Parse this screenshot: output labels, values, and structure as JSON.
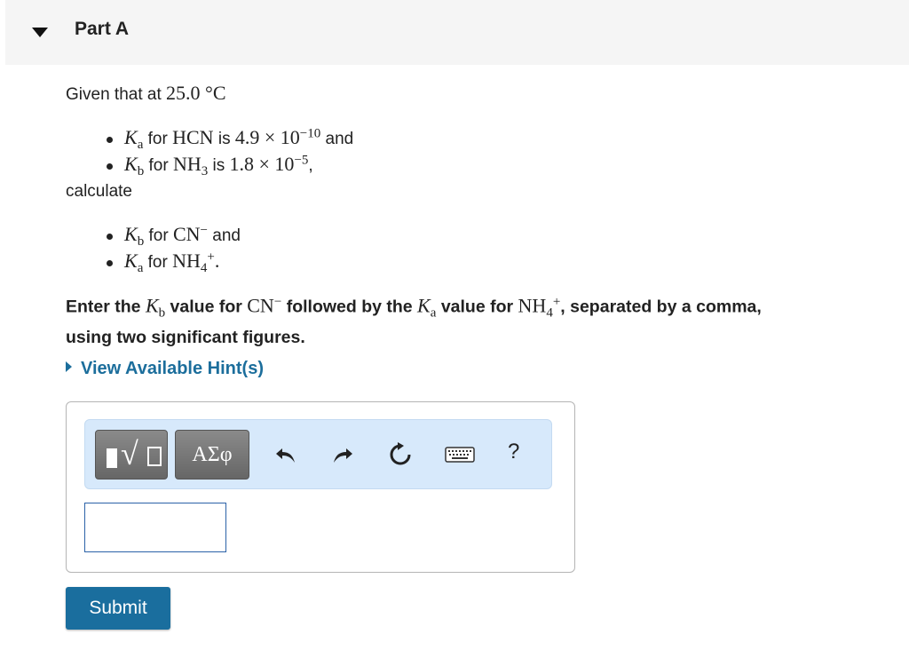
{
  "header": {
    "title": "Part A"
  },
  "question": {
    "intro_text": "Given that at",
    "temperature": "25.0 °C",
    "given": [
      {
        "symbol": "K",
        "sub": "a",
        "for_text": "for",
        "species": "HCN",
        "species_sup": "",
        "species_sub": "",
        "is_text": "is",
        "value": "4.9 × 10",
        "exponent": "−10",
        "tail": "and"
      },
      {
        "symbol": "K",
        "sub": "b",
        "for_text": "for",
        "species": "NH",
        "species_sub": "3",
        "species_sup": "",
        "is_text": "is",
        "value": "1.8 × 10",
        "exponent": "−5",
        "tail": ","
      }
    ],
    "calculate_text": "calculate",
    "targets": [
      {
        "symbol": "K",
        "sub": "b",
        "for_text": "for",
        "species": "CN",
        "species_sub": "",
        "species_sup": "−",
        "tail": "and"
      },
      {
        "symbol": "K",
        "sub": "a",
        "for_text": "for",
        "species": "NH",
        "species_sub": "4",
        "species_sup": "+",
        "tail": "."
      }
    ],
    "instruction": {
      "part1": "Enter the",
      "k1_symbol": "K",
      "k1_sub": "b",
      "part2": "value for",
      "sp1": "CN",
      "sp1_sup": "−",
      "part3": "followed by the",
      "k2_symbol": "K",
      "k2_sub": "a",
      "part4": "value for",
      "sp2": "NH",
      "sp2_sub": "4",
      "sp2_sup": "+",
      "part5": ", separated by a comma,",
      "line2": "using two significant figures."
    }
  },
  "hint_link": "View Available Hint(s)",
  "toolbar": {
    "greek_label": "ΑΣφ",
    "help_label": "?",
    "icons": [
      "templates-icon",
      "greek-symbols-icon",
      "undo-icon",
      "redo-icon",
      "reset-icon",
      "keyboard-icon",
      "help-icon"
    ]
  },
  "answer": {
    "value": "",
    "placeholder": ""
  },
  "submit_label": "Submit",
  "colors": {
    "accent": "#1a6e9e",
    "link": "#1c6e9c",
    "toolbar_bg": "#d7e9fb",
    "header_bg": "#f5f5f5"
  }
}
